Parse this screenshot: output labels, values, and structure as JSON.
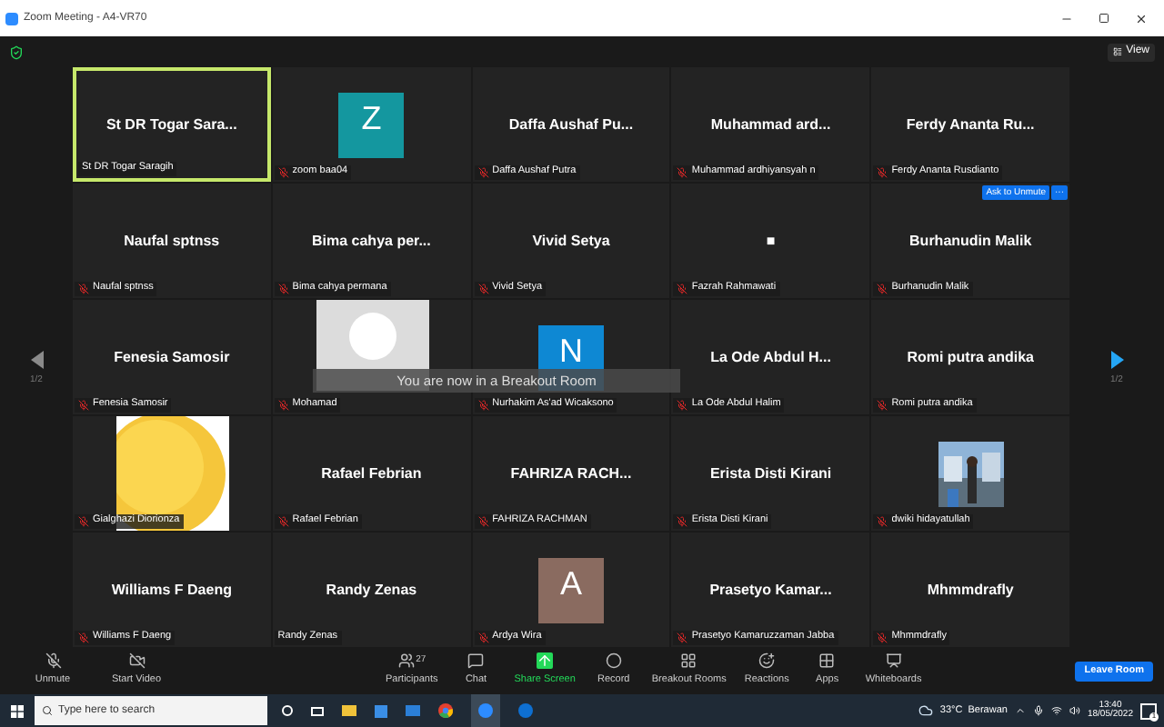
{
  "window": {
    "title": "Zoom Meeting - A4-VR70"
  },
  "top_bar": {
    "view_button": "View"
  },
  "pager": {
    "left": "1/2",
    "right": "1/2"
  },
  "tiles": [
    {
      "display": {
        "kind": "text",
        "text": "St DR Togar Sara..."
      },
      "label": "St DR Togar Saragih",
      "muted": false,
      "speaking": true
    },
    {
      "display": {
        "kind": "letter",
        "text": "Z",
        "color": "#14979f"
      },
      "label": "zoom baa04",
      "muted": true,
      "speaking": false
    },
    {
      "display": {
        "kind": "text",
        "text": "Daffa  Aushaf Pu..."
      },
      "label": "Daffa Aushaf Putra",
      "muted": true,
      "speaking": false
    },
    {
      "display": {
        "kind": "text",
        "text": "Muhammad  ard..."
      },
      "label": "Muhammad ardhiyansyah n",
      "muted": true,
      "speaking": false
    },
    {
      "display": {
        "kind": "text",
        "text": "Ferdy  Ananta  Ru..."
      },
      "label": "Ferdy Ananta Rusdianto",
      "muted": true,
      "speaking": false
    },
    {
      "display": {
        "kind": "text",
        "text": "Naufal sptnss"
      },
      "label": "Naufal sptnss",
      "muted": true,
      "speaking": false
    },
    {
      "display": {
        "kind": "text",
        "text": "Bima  cahya  per..."
      },
      "label": "Bima cahya permana",
      "muted": true,
      "speaking": false
    },
    {
      "display": {
        "kind": "text",
        "text": "Vivid Setya"
      },
      "label": "Vivid Setya",
      "muted": true,
      "speaking": false
    },
    {
      "display": {
        "kind": "text",
        "text": "■"
      },
      "label": "Fazrah Rahmawati",
      "muted": true,
      "speaking": false
    },
    {
      "display": {
        "kind": "text",
        "text": "Burhanudin Malik"
      },
      "label": "Burhanudin Malik",
      "muted": true,
      "speaking": false,
      "overlay_buttons": [
        "Ask to Unmute",
        "···"
      ]
    },
    {
      "display": {
        "kind": "text",
        "text": "Fenesia Samosir"
      },
      "label": "Fenesia Samosir",
      "muted": true,
      "speaking": false
    },
    {
      "display": {
        "kind": "silhouette"
      },
      "label": "Mohamad",
      "muted": true,
      "speaking": false
    },
    {
      "display": {
        "kind": "letter",
        "text": "N",
        "color": "#0e88d3"
      },
      "label": "Nurhakim As'ad Wicaksono",
      "muted": true,
      "speaking": false
    },
    {
      "display": {
        "kind": "text",
        "text": "La Ode Abdul H..."
      },
      "label": "La Ode Abdul Halim",
      "muted": true,
      "speaking": false
    },
    {
      "display": {
        "kind": "text",
        "text": "Romi putra andika"
      },
      "label": "Romi putra andika",
      "muted": true,
      "speaking": false
    },
    {
      "display": {
        "kind": "emoji"
      },
      "label": "Gialghazi Diorionza",
      "muted": true,
      "speaking": false
    },
    {
      "display": {
        "kind": "text",
        "text": "Rafael Febrian"
      },
      "label": "Rafael Febrian",
      "muted": true,
      "speaking": false
    },
    {
      "display": {
        "kind": "text",
        "text": "FAHRIZA  RACH..."
      },
      "label": "FAHRIZA RACHMAN",
      "muted": true,
      "speaking": false
    },
    {
      "display": {
        "kind": "text",
        "text": "Erista Disti Kirani"
      },
      "label": "Erista Disti Kirani",
      "muted": true,
      "speaking": false
    },
    {
      "label": "dwiki hidayatullah",
      "muted": true,
      "speaking": false
    },
    {
      "display": {
        "kind": "text",
        "text": "Williams F Daeng"
      },
      "label": "Williams F Daeng",
      "muted": true,
      "speaking": false
    },
    {
      "display": {
        "kind": "text",
        "text": "Randy Zenas"
      },
      "label": "Randy Zenas",
      "muted": false,
      "speaking": false
    },
    {
      "display": {
        "kind": "letter",
        "text": "A",
        "color": "#8a6b60"
      },
      "label": "Ardya Wira",
      "muted": true,
      "speaking": false
    },
    {
      "display": {
        "kind": "text",
        "text": "Prasetyo  Kamar..."
      },
      "label": "Prasetyo Kamaruzzaman Jabba",
      "muted": true,
      "speaking": false
    },
    {
      "display": {
        "kind": "text",
        "text": "Mhmmdrafly"
      },
      "label": "Mhmmdrafly",
      "muted": true,
      "speaking": false
    }
  ],
  "toast": "You are now in a Breakout Room",
  "toolbar_left": [
    {
      "kind": "mic",
      "label": "Unmute"
    },
    {
      "kind": "video",
      "label": "Start Video"
    }
  ],
  "toolbar_center": [
    {
      "kind": "participants",
      "label": "Participants",
      "count": "27"
    },
    {
      "kind": "chat",
      "label": "Chat"
    },
    {
      "kind": "share",
      "label": "Share Screen"
    },
    {
      "kind": "record",
      "label": "Record"
    },
    {
      "kind": "breakout",
      "label": "Breakout Rooms"
    },
    {
      "kind": "reactions",
      "label": "Reactions"
    },
    {
      "kind": "apps",
      "label": "Apps"
    },
    {
      "kind": "whiteboards",
      "label": "Whiteboards"
    }
  ],
  "leave_button": "Leave Room",
  "taskbar": {
    "search_placeholder": "Type here to search",
    "weather": "33°C  Berawan",
    "time": "13:40",
    "date": "18/05/2022",
    "notifications": "1"
  }
}
